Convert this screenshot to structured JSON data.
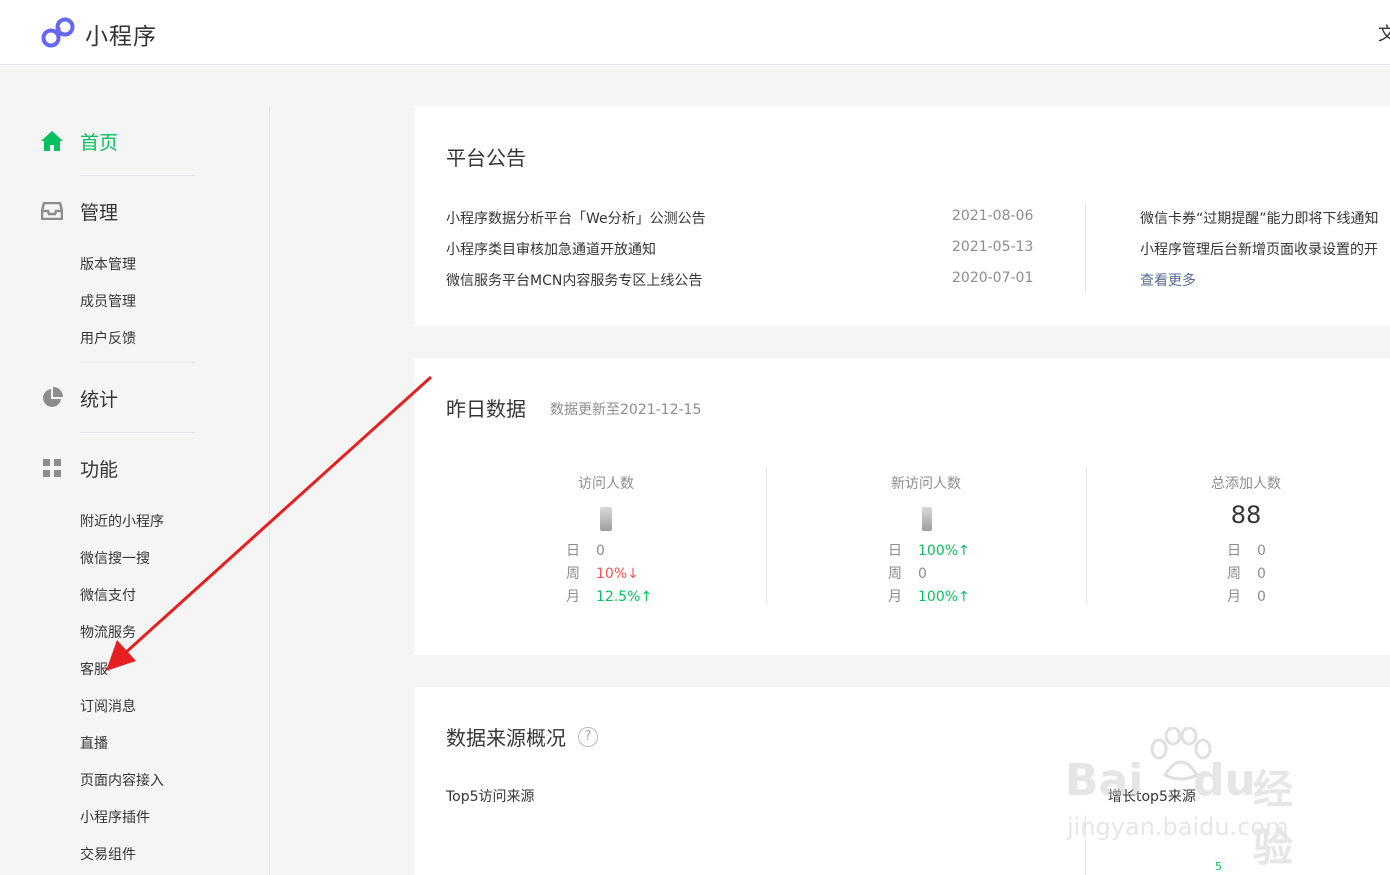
{
  "header": {
    "app_title": "小程序",
    "right_text": "文"
  },
  "sidebar": {
    "home": "首页",
    "manage": "管理",
    "manage_items": [
      "版本管理",
      "成员管理",
      "用户反馈"
    ],
    "stats": "统计",
    "features": "功能",
    "feature_items": [
      "附近的小程序",
      "微信搜一搜",
      "微信支付",
      "物流服务",
      "客服",
      "订阅消息",
      "直播",
      "页面内容接入",
      "小程序插件",
      "交易组件"
    ]
  },
  "notice": {
    "title": "平台公告",
    "left": [
      {
        "text": "小程序数据分析平台「We分析」公测公告",
        "date": "2021-08-06"
      },
      {
        "text": "小程序类目审核加急通道开放通知",
        "date": "2021-05-13"
      },
      {
        "text": "微信服务平台MCN内容服务专区上线公告",
        "date": "2020-07-01"
      }
    ],
    "right": [
      "微信卡券“过期提醒”能力即将下线通知",
      "小程序管理后台新增页面收录设置的开"
    ],
    "more": "查看更多"
  },
  "yesterday": {
    "title": "昨日数据",
    "update_note": "数据更新至2021-12-15",
    "columns": [
      {
        "label": "访问人数",
        "value": "",
        "rows": [
          {
            "k": "日",
            "v": "0",
            "trend": "none"
          },
          {
            "k": "周",
            "v": "10%↓",
            "trend": "down"
          },
          {
            "k": "月",
            "v": "12.5%↑",
            "trend": "up"
          }
        ]
      },
      {
        "label": "新访问人数",
        "value": "",
        "rows": [
          {
            "k": "日",
            "v": "100%↑",
            "trend": "up"
          },
          {
            "k": "周",
            "v": "0",
            "trend": "none"
          },
          {
            "k": "月",
            "v": "100%↑",
            "trend": "up"
          }
        ]
      },
      {
        "label": "总添加人数",
        "value": "88",
        "rows": [
          {
            "k": "日",
            "v": "0",
            "trend": "none"
          },
          {
            "k": "周",
            "v": "0",
            "trend": "none"
          },
          {
            "k": "月",
            "v": "0",
            "trend": "none"
          }
        ]
      }
    ]
  },
  "source": {
    "title": "数据来源概况",
    "help": "?",
    "top5": "Top5访问来源",
    "growth_label": "增长top5来源",
    "axis_tick": "5"
  },
  "watermark": {
    "brand": "Bai",
    "brand2": "du",
    "cn": "经验",
    "url": "jingyan.baidu.com"
  },
  "colors": {
    "accent": "#07c160",
    "link": "#576b95",
    "down": "#fa5151",
    "annotation_arrow": "#e62020"
  }
}
